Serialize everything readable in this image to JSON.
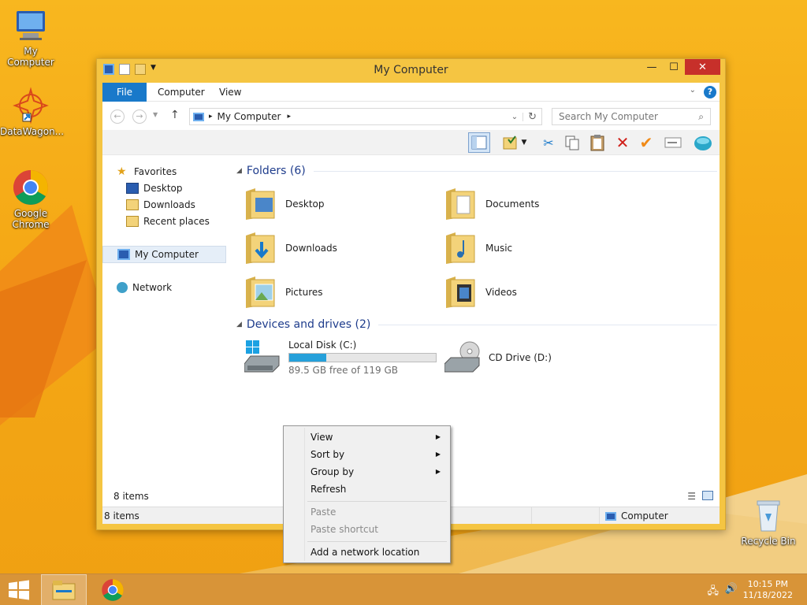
{
  "desktop": {
    "icons": [
      {
        "label": "My Computer"
      },
      {
        "label": "DataWagon..."
      },
      {
        "label": "Google Chrome"
      },
      {
        "label": "Recycle Bin"
      }
    ]
  },
  "window": {
    "title": "My Computer",
    "tabs": {
      "file": "File",
      "computer": "Computer",
      "view": "View"
    },
    "address": {
      "path": "My Computer"
    },
    "search": {
      "placeholder": "Search My Computer"
    }
  },
  "navpane": {
    "favorites": "Favorites",
    "desktop": "Desktop",
    "downloads": "Downloads",
    "recent": "Recent places",
    "mycomputer": "My Computer",
    "network": "Network"
  },
  "content": {
    "folders_header": "Folders (6)",
    "folders": [
      {
        "name": "Desktop"
      },
      {
        "name": "Documents"
      },
      {
        "name": "Downloads"
      },
      {
        "name": "Music"
      },
      {
        "name": "Pictures"
      },
      {
        "name": "Videos"
      }
    ],
    "devices_header": "Devices and drives (2)",
    "drives": [
      {
        "name": "Local Disk (C:)",
        "free": "89.5 GB free of 119 GB",
        "used_fraction": 0.25
      },
      {
        "name": "CD Drive (D:)"
      }
    ]
  },
  "status": {
    "items_upper": "8 items",
    "items_lower": "8 items",
    "location": "Computer"
  },
  "context_menu": {
    "view": "View",
    "sortby": "Sort by",
    "groupby": "Group by",
    "refresh": "Refresh",
    "paste": "Paste",
    "paste_shortcut": "Paste shortcut",
    "add_network": "Add a network location"
  },
  "taskbar": {
    "time": "10:15 PM",
    "date": "11/18/2022"
  },
  "colors": {
    "accent": "#1979ca",
    "close": "#c7302a",
    "frame": "#f5c542"
  }
}
